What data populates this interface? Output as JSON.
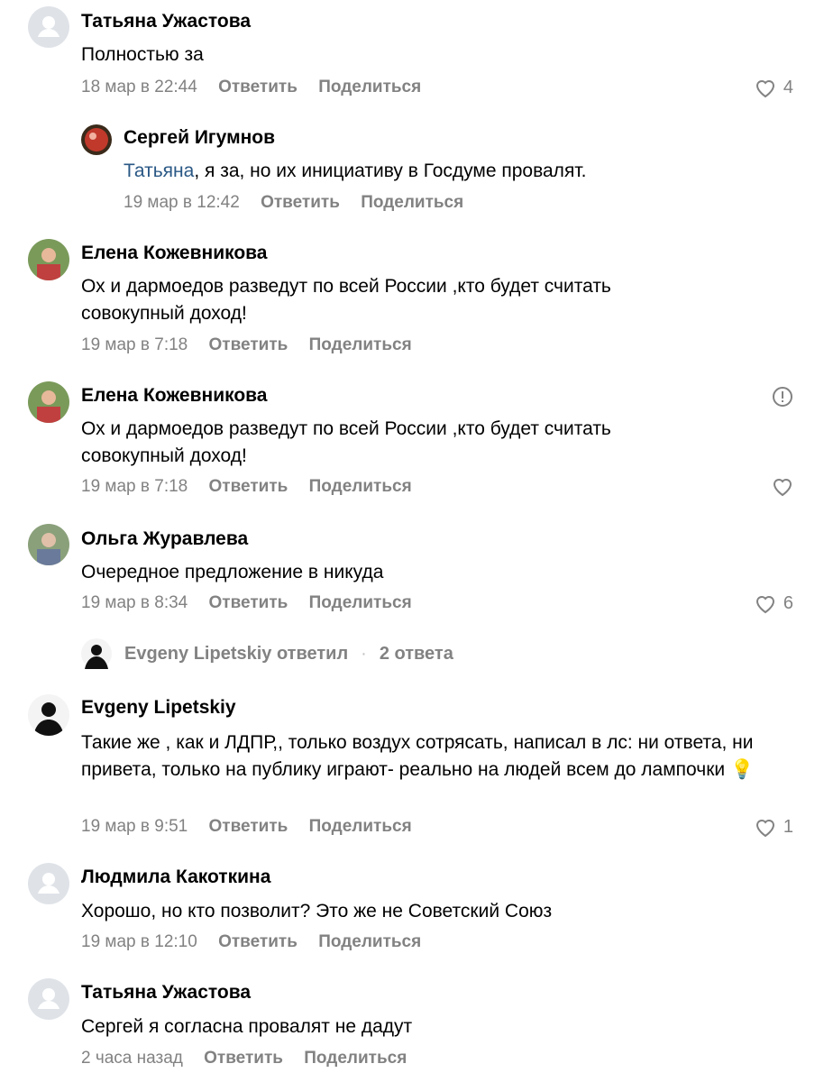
{
  "actions": {
    "reply": "Ответить",
    "share": "Поделиться"
  },
  "comments": [
    {
      "author": "Татьяна Ужастова",
      "text": "Полностью за",
      "date": "18 мар в 22:44",
      "likes": "4"
    },
    {
      "author": "Сергей Игумнов",
      "mention": "Татьяна",
      "text": ", я за, но их инициативу в Госдуме провалят.",
      "date": "19 мар в 12:42"
    },
    {
      "author": "Елена Кожевникова",
      "text": "Ох и дармоедов разведут по всей России ,кто будет считать совокупный доход!",
      "date": "19 мар в 7:18"
    },
    {
      "author": "Елена Кожевникова",
      "text": "Ох и дармоедов разведут по всей России ,кто будет считать совокупный доход!",
      "date": "19 мар в 7:18"
    },
    {
      "author": "Ольга Журавлева",
      "text": "Очередное предложение в никуда",
      "date": "19 мар в 8:34",
      "likes": "6"
    },
    {
      "author": "Evgeny Lipetskiy",
      "text": "Такие же , как и ЛДПР,, только воздух сотрясать, написал в лс: ни ответа, ни привета, только на публику играют- реально на людей всем до лампочки",
      "emoji": "💡",
      "date": "19 мар в 9:51",
      "likes": "1"
    },
    {
      "author": "Людмила Какоткина",
      "text": "Хорошо, но кто позволит? Это же не Советский Союз",
      "date": "19 мар в 12:10"
    },
    {
      "author": "Татьяна Ужастова",
      "text": "Сергей я согласна провалят не дадут",
      "date": "2 часа назад"
    }
  ],
  "thread_summary": {
    "replier": "Evgeny Lipetskiy ответил",
    "separator": "·",
    "count": "2 ответа"
  },
  "colors": {
    "meta": "#828282",
    "mention": "#2a5885",
    "avatar_default": "#dfe3e8"
  }
}
